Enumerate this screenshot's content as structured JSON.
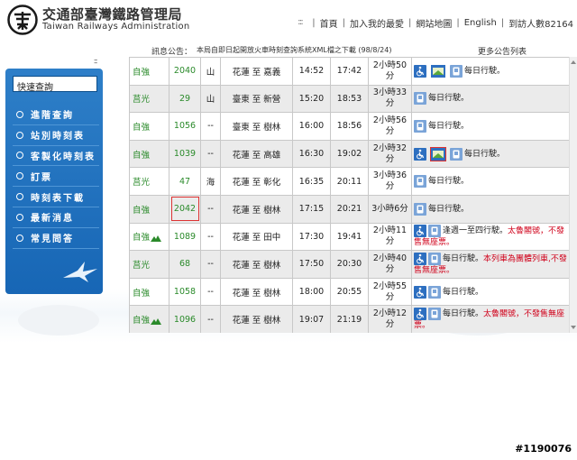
{
  "header": {
    "brand_cn": "交通部臺灣鐵路管理局",
    "brand_en": "Taiwan Railways Administration",
    "nav": [
      {
        "label": "首頁"
      },
      {
        "label": "加入我的最愛"
      },
      {
        "label": "網站地圖"
      },
      {
        "label": "English"
      },
      {
        "label": "到訪人數82164"
      }
    ]
  },
  "notice": {
    "label": "訊息公告：",
    "text": "本局自即日起開放火車時刻查詢系統XML檔之下載 (98/8/24)",
    "more": "更多公告列表"
  },
  "sidebar": {
    "quick_search": "快速查詢",
    "items": [
      {
        "label": "進階查詢"
      },
      {
        "label": "站別時刻表"
      },
      {
        "label": "客製化時刻表"
      },
      {
        "label": "訂票"
      },
      {
        "label": "時刻表下載"
      },
      {
        "label": "最新消息"
      },
      {
        "label": "常見問答"
      }
    ]
  },
  "table": {
    "rows": [
      {
        "type": "自強",
        "train_no": "2040",
        "line": "山",
        "route": "花蓮 至 嘉義",
        "dep": "14:52",
        "arr": "17:42",
        "dur": "2小時50分",
        "icons": [
          "wheelchair",
          "bento",
          "bike"
        ],
        "note": "每日行駛。",
        "note_extra": ""
      },
      {
        "type": "莒光",
        "train_no": "29",
        "line": "山",
        "route": "臺東 至 新營",
        "dep": "15:20",
        "arr": "18:53",
        "dur": "3小時33分",
        "icons": [
          "bike"
        ],
        "note": "每日行駛。",
        "note_extra": ""
      },
      {
        "type": "自強",
        "train_no": "1056",
        "line": "--",
        "route": "臺東 至 樹林",
        "dep": "16:00",
        "arr": "18:56",
        "dur": "2小時56分",
        "icons": [
          "bike"
        ],
        "note": "每日行駛。",
        "note_extra": ""
      },
      {
        "type": "自強",
        "train_no": "1039",
        "line": "--",
        "route": "花蓮 至 高雄",
        "dep": "16:30",
        "arr": "19:02",
        "dur": "2小時32分",
        "icons": [
          "wheelchair",
          "bento",
          "bike"
        ],
        "note": "每日行駛。",
        "note_extra": ""
      },
      {
        "type": "莒光",
        "train_no": "47",
        "line": "海",
        "route": "花蓮 至 彰化",
        "dep": "16:35",
        "arr": "20:11",
        "dur": "3小時36分",
        "icons": [
          "bike"
        ],
        "note": "每日行駛。",
        "note_extra": ""
      },
      {
        "type": "自強",
        "train_no": "2042",
        "line": "--",
        "route": "花蓮 至 樹林",
        "dep": "17:15",
        "arr": "20:21",
        "dur": "3小時6分",
        "icons": [
          "bike"
        ],
        "note": "每日行駛。",
        "note_extra": ""
      },
      {
        "type": "自強",
        "train_no": "1089",
        "line": "--",
        "route": "花蓮 至 田中",
        "dep": "17:30",
        "arr": "19:41",
        "dur": "2小時11分",
        "icons": [
          "wheelchair",
          "bike"
        ],
        "note": "逢週一至四行駛。",
        "note_extra": "太魯閣號，不發售無座票。"
      },
      {
        "type": "莒光",
        "train_no": "68",
        "line": "--",
        "route": "花蓮 至 樹林",
        "dep": "17:50",
        "arr": "20:30",
        "dur": "2小時40分",
        "icons": [
          "wheelchair",
          "bike"
        ],
        "note": "每日行駛。",
        "note_extra": "本列車為團體列車,不發售無座票。"
      },
      {
        "type": "自強",
        "train_no": "1058",
        "line": "--",
        "route": "花蓮 至 樹林",
        "dep": "18:00",
        "arr": "20:55",
        "dur": "2小時55分",
        "icons": [
          "wheelchair",
          "bike"
        ],
        "note": "每日行駛。",
        "note_extra": ""
      },
      {
        "type": "自強",
        "train_no": "1096",
        "line": "--",
        "route": "花蓮 至 樹林",
        "dep": "19:07",
        "arr": "21:19",
        "dur": "2小時12分",
        "icons": [
          "wheelchair",
          "bike"
        ],
        "note": "每日行駛。",
        "note_extra": "太魯閣號，不發售無座票。"
      }
    ]
  },
  "watermark": "#1190076",
  "colors": {
    "sidebar_blue": "#1f72bf",
    "train_type_green": "#2a8a2a",
    "warning_red": "#d0021b",
    "icon_blue": "#2d6fc0"
  }
}
